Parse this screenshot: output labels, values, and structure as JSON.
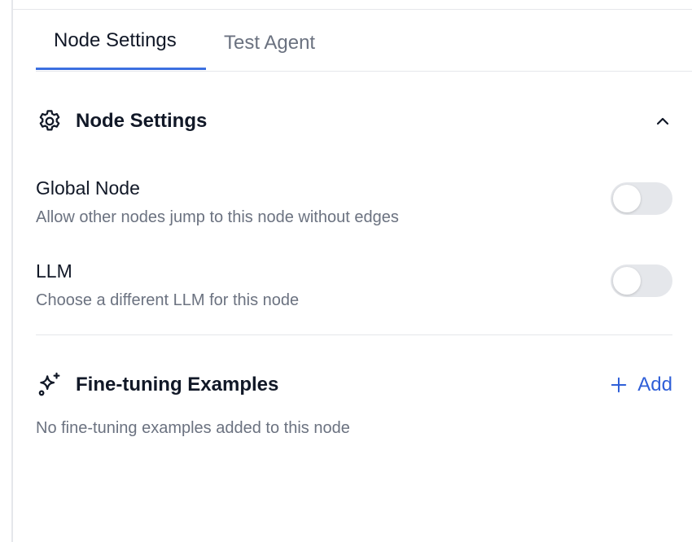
{
  "tabs": [
    {
      "label": "Node Settings",
      "active": true
    },
    {
      "label": "Test Agent",
      "active": false
    }
  ],
  "node_settings": {
    "title": "Node Settings",
    "icon": "gear-icon",
    "expanded": true,
    "global_node": {
      "title": "Global Node",
      "description": "Allow other nodes jump to this node without edges",
      "enabled": false
    },
    "llm": {
      "title": "LLM",
      "description": "Choose a different LLM for this node",
      "enabled": false
    }
  },
  "fine_tuning": {
    "title": "Fine-tuning Examples",
    "icon": "sparkles-icon",
    "add_label": "Add",
    "empty_text": "No fine-tuning examples added to this node"
  },
  "colors": {
    "accent": "#3b6fe0",
    "link": "#2f5fd8",
    "toggle_off": "#e5e7eb",
    "muted_text": "#6b7280"
  }
}
